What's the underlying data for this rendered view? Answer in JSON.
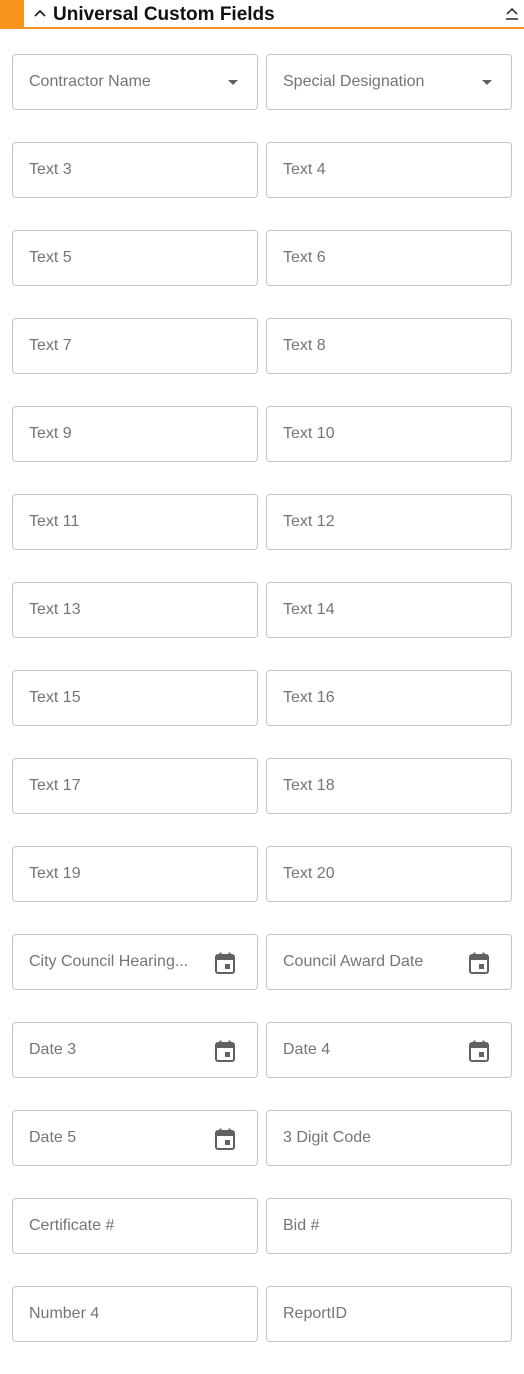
{
  "section": {
    "title": "Universal Custom Fields",
    "expand_icon": "chevron-up-icon",
    "collapse_icon": "collapse-arrow-icon",
    "accent_color": "#f7941d"
  },
  "fields": [
    [
      {
        "label": "Contractor Name",
        "type": "select"
      },
      {
        "label": "Special Designation",
        "type": "select"
      }
    ],
    [
      {
        "label": "Text 3",
        "type": "text"
      },
      {
        "label": "Text 4",
        "type": "text"
      }
    ],
    [
      {
        "label": "Text 5",
        "type": "text"
      },
      {
        "label": "Text 6",
        "type": "text"
      }
    ],
    [
      {
        "label": "Text 7",
        "type": "text"
      },
      {
        "label": "Text 8",
        "type": "text"
      }
    ],
    [
      {
        "label": "Text 9",
        "type": "text"
      },
      {
        "label": "Text 10",
        "type": "text"
      }
    ],
    [
      {
        "label": "Text 11",
        "type": "text"
      },
      {
        "label": "Text 12",
        "type": "text"
      }
    ],
    [
      {
        "label": "Text 13",
        "type": "text"
      },
      {
        "label": "Text 14",
        "type": "text"
      }
    ],
    [
      {
        "label": "Text 15",
        "type": "text"
      },
      {
        "label": "Text 16",
        "type": "text"
      }
    ],
    [
      {
        "label": "Text 17",
        "type": "text"
      },
      {
        "label": "Text 18",
        "type": "text"
      }
    ],
    [
      {
        "label": "Text 19",
        "type": "text"
      },
      {
        "label": "Text 20",
        "type": "text"
      }
    ],
    [
      {
        "label": "City Council Hearing...",
        "type": "date"
      },
      {
        "label": "Council Award Date",
        "type": "date"
      }
    ],
    [
      {
        "label": "Date 3",
        "type": "date"
      },
      {
        "label": "Date 4",
        "type": "date"
      }
    ],
    [
      {
        "label": "Date 5",
        "type": "date"
      },
      {
        "label": "3 Digit Code",
        "type": "text"
      }
    ],
    [
      {
        "label": "Certificate #",
        "type": "text"
      },
      {
        "label": "Bid #",
        "type": "text"
      }
    ],
    [
      {
        "label": "Number 4",
        "type": "text"
      },
      {
        "label": "ReportID",
        "type": "text"
      }
    ]
  ]
}
